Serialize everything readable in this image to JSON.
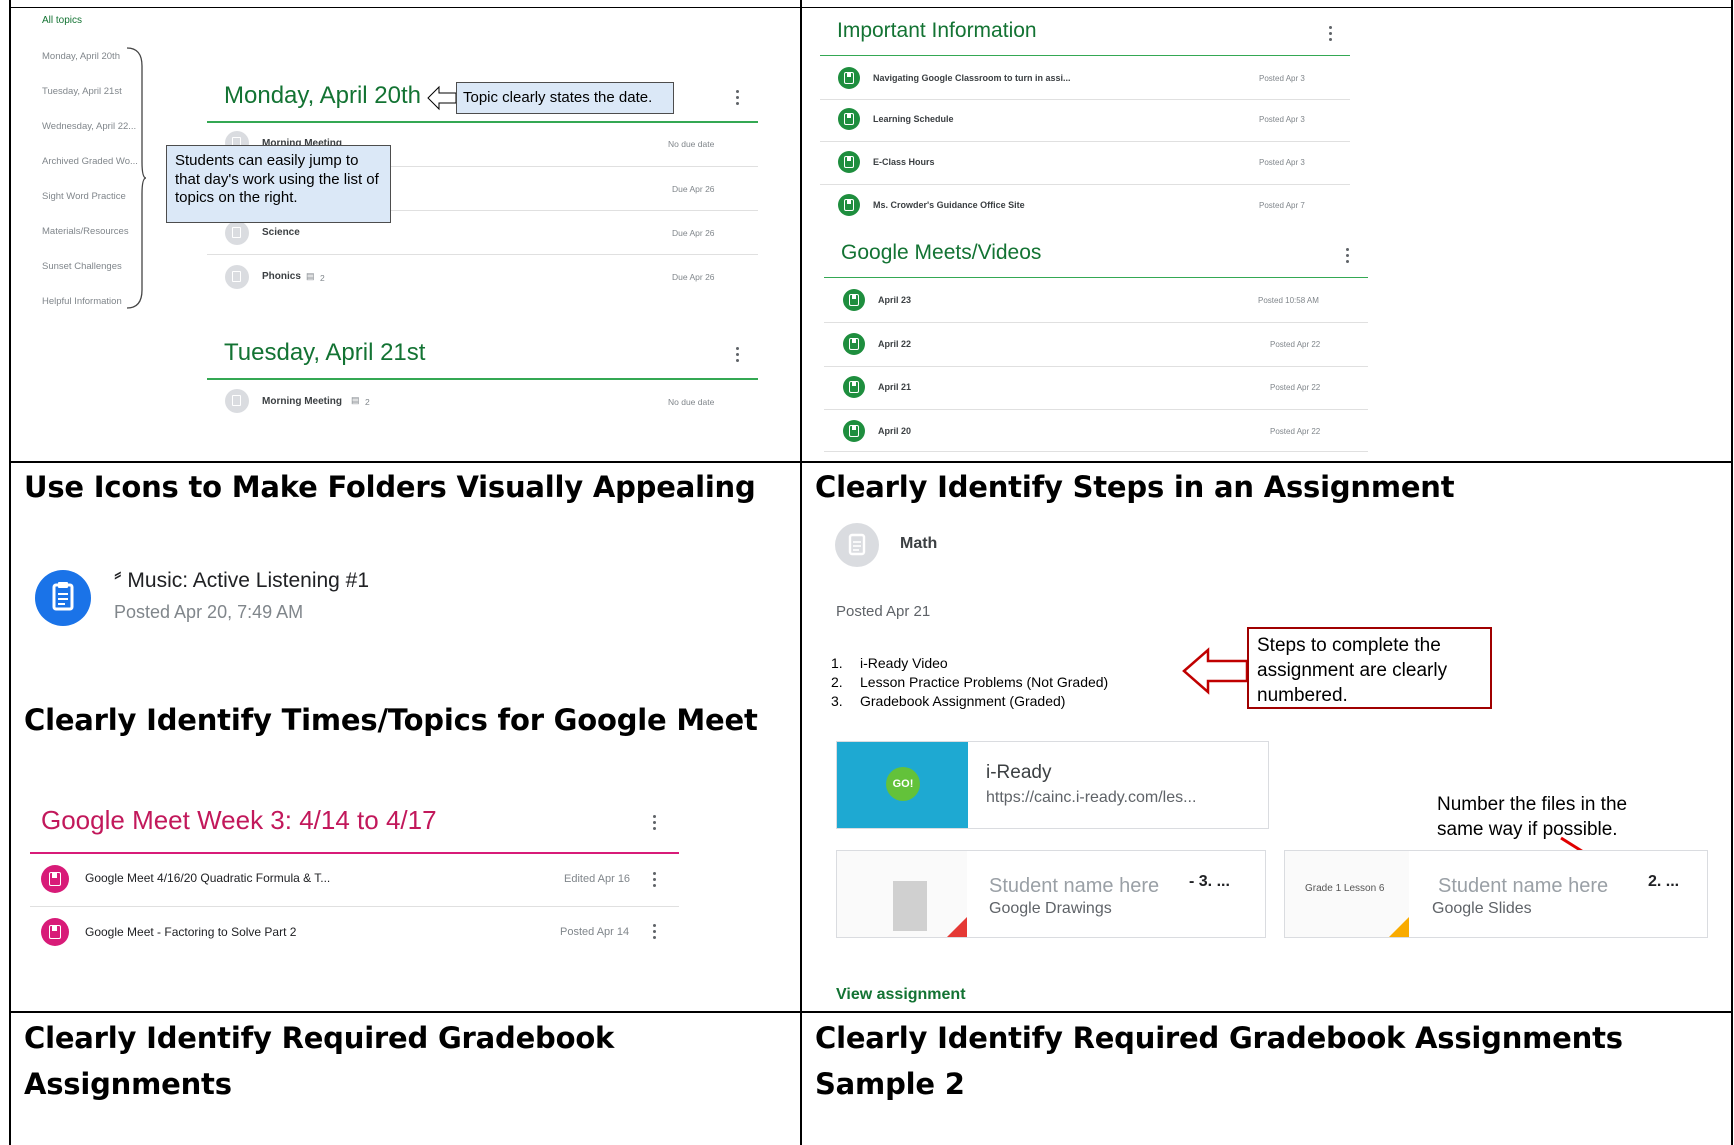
{
  "headings": {
    "icons": "Use Icons to Make Folders Visually Appealing",
    "steps": "Clearly Identify Steps in an Assignment",
    "meet": "Clearly Identify Times/Topics for Google Meet",
    "gradebook1_line1": "Clearly Identify Required Gradebook",
    "gradebook1_line2": "Assignments",
    "gradebook2_line1": "Clearly Identify Required Gradebook Assignments",
    "gradebook2_line2": "Sample 2"
  },
  "topics_panel": {
    "all_topics": "All topics",
    "sidebar": [
      "Monday, April 20th",
      "Tuesday, April 21st",
      "Wednesday, April 22...",
      "Archived Graded Wo...",
      "Sight Word Practice",
      "Materials/Resources",
      "Sunset Challenges",
      "Helpful Information"
    ],
    "monday_title": "Monday, April 20th",
    "tuesday_title": "Tuesday, April 21st",
    "callout_date": "Topic clearly states the date.",
    "callout_jump": "Students can easily jump to that day's work using the list of topics on the right.",
    "rows": [
      {
        "title": "Morning Meeting",
        "meta": "No due date"
      },
      {
        "title": "",
        "meta": "Due Apr 26"
      },
      {
        "title": "Science",
        "meta": "Due Apr 26"
      },
      {
        "title": "Phonics",
        "comments": "2",
        "meta": "Due Apr 26"
      }
    ],
    "tuesday_row": {
      "title": "Morning Meeting",
      "comments": "2",
      "meta": "No due date"
    }
  },
  "info_panel": {
    "important_title": "Important Information",
    "important_rows": [
      {
        "title": "Navigating Google Classroom to turn in assi...",
        "meta": "Posted Apr 3"
      },
      {
        "title": "Learning Schedule",
        "meta": "Posted Apr 3"
      },
      {
        "title": "E-Class Hours",
        "meta": "Posted Apr 3"
      },
      {
        "title": "Ms. Crowder's Guidance Office Site",
        "meta": "Posted Apr 7"
      }
    ],
    "meets_title": "Google Meets/Videos",
    "meets_rows": [
      {
        "title": "April 23",
        "meta": "Posted 10:58 AM"
      },
      {
        "title": "April 22",
        "meta": "Posted Apr 22"
      },
      {
        "title": "April 21",
        "meta": "Posted Apr 22"
      },
      {
        "title": "April 20",
        "meta": "Posted Apr 22"
      }
    ]
  },
  "music_post": {
    "title": "𝅫 Music: Active Listening #1",
    "posted": "Posted Apr 20, 7:49 AM"
  },
  "meet_topic": {
    "title": "Google Meet Week 3: 4/14 to 4/17",
    "rows": [
      {
        "title": "Google Meet 4/16/20 Quadratic Formula & T...",
        "meta": "Edited Apr 16"
      },
      {
        "title": "Google Meet - Factoring to Solve Part 2",
        "meta": "Posted Apr 14"
      }
    ]
  },
  "math_assignment": {
    "title": "Math",
    "posted": "Posted Apr 21",
    "steps": [
      "i-Ready Video",
      "Lesson Practice Problems (Not Graded)",
      "Gradebook Assignment (Graded)"
    ],
    "step_numbers": [
      "1.",
      "2.",
      "3."
    ],
    "callout_steps": "Steps to complete the assignment are clearly numbered.",
    "callout_files": "Number the files in the same way if possible.",
    "link_title": "i-Ready",
    "link_url": "https://cainc.i-ready.com/les...",
    "go_badge": "GO!",
    "file1_name": "Student name here",
    "file1_num": "- 3. ...",
    "file1_type": "Google Drawings",
    "file2_thumb": "Grade 1 Lesson 6",
    "file2_name": "Student name here",
    "file2_num": "2. ...",
    "file2_type": "Google Slides",
    "view_link": "View assignment"
  },
  "colors": {
    "classroom_green": "#137333",
    "meet_pink": "#c2185b",
    "callout_red": "#c00000",
    "callout_blue": "#dbe8f7"
  }
}
